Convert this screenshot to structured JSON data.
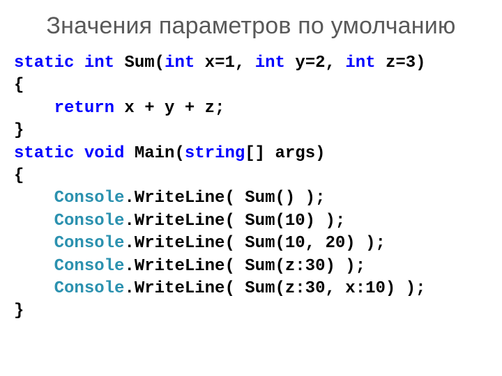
{
  "title": "Значения параметров по умолчанию",
  "code": {
    "kw_static": "static",
    "kw_int": "int",
    "kw_void": "void",
    "kw_return": "return",
    "kw_string": "string",
    "type_console": "Console",
    "sum_name": " Sum(",
    "sum_p1": " x=1, ",
    "sum_p2": " y=2, ",
    "sum_p3": " z=3)",
    "brace_open": "{",
    "brace_close": "}",
    "return_expr": " x + y + z;",
    "main_sig_a": " Main(",
    "main_sig_b": "[] args)",
    "w1": ".WriteLine( Sum() );",
    "w2": ".WriteLine( Sum(10) );",
    "w3": ".WriteLine( Sum(10, 20) );",
    "w4": ".WriteLine( Sum(z:30) );",
    "w5": ".WriteLine( Sum(z:30, x:10) );",
    "indent": "    "
  }
}
